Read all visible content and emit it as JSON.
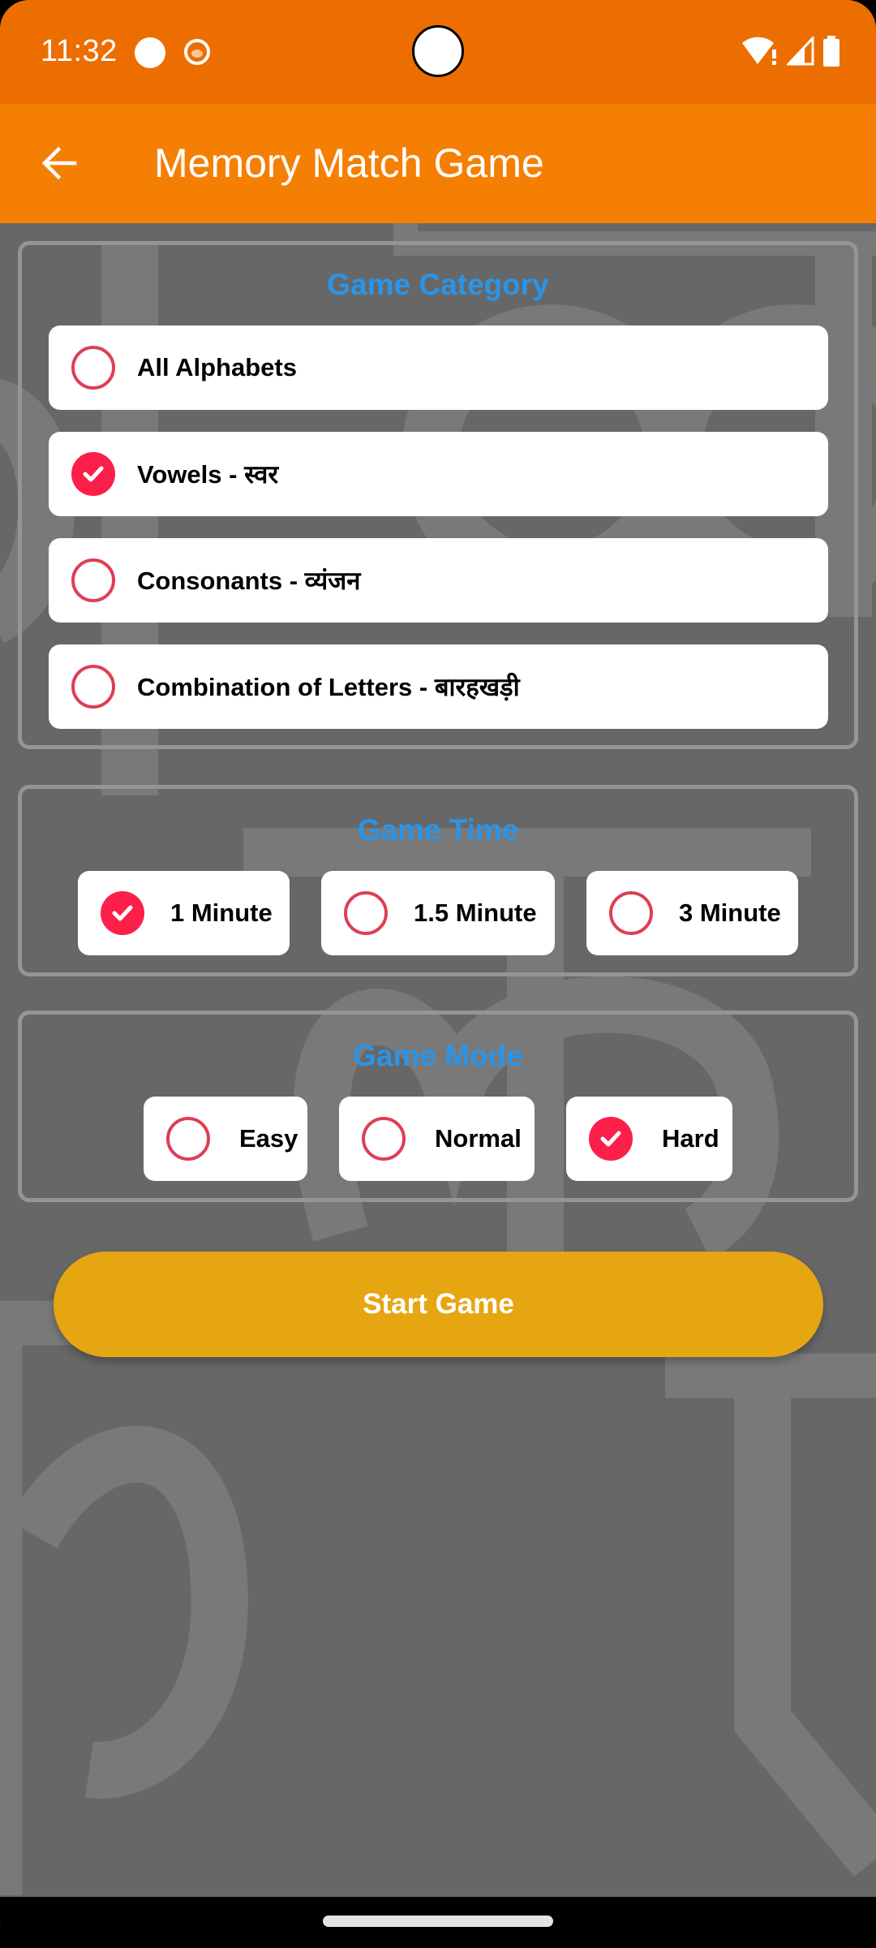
{
  "status_bar": {
    "time": "11:32",
    "icons": [
      "notification-dot-icon",
      "cat-app-icon",
      "wifi-alert-icon",
      "cell-signal-icon",
      "battery-icon"
    ]
  },
  "app_bar": {
    "back_icon": "arrow-left-icon",
    "title": "Memory Match Game"
  },
  "colors": {
    "status_bar": "#ED6E00",
    "app_bar": "#F57F02",
    "section_title": "#2A95E8",
    "radio_checked": "#FB1F4A",
    "radio_unchecked_border": "#DD3F55",
    "start_button": "#E6A612",
    "background": "#676767"
  },
  "sections": {
    "category": {
      "title": "Game Category",
      "options": [
        {
          "label": "All Alphabets",
          "selected": false
        },
        {
          "label": "Vowels - स्वर",
          "selected": true
        },
        {
          "label": "Consonants - व्यंजन",
          "selected": false
        },
        {
          "label": "Combination of Letters - बारहखड़ी",
          "selected": false
        }
      ]
    },
    "time": {
      "title": "Game Time",
      "options": [
        {
          "label": "1 Minute",
          "selected": true
        },
        {
          "label": "1.5 Minute",
          "selected": false
        },
        {
          "label": "3 Minute",
          "selected": false
        }
      ]
    },
    "mode": {
      "title": "Game Mode",
      "options": [
        {
          "label": "Easy",
          "selected": false
        },
        {
          "label": "Normal",
          "selected": false
        },
        {
          "label": "Hard",
          "selected": true
        }
      ]
    }
  },
  "start_button": {
    "label": "Start Game"
  }
}
